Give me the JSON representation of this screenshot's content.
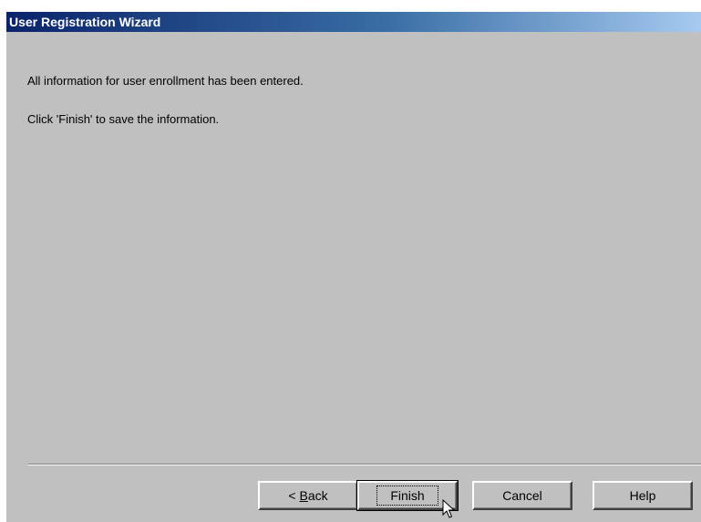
{
  "window": {
    "title": "User Registration Wizard"
  },
  "content": {
    "message_line1": "All information for user enrollment has been entered.",
    "message_line2": "Click 'Finish' to save the information."
  },
  "buttons": {
    "back_prefix": "< ",
    "back_mnemonic": "B",
    "back_rest": "ack",
    "finish": "Finish",
    "cancel": "Cancel",
    "help": "Help"
  },
  "colors": {
    "title_bar_start": "#0a246a",
    "title_bar_end": "#a6caf0",
    "dialog_background": "#c0c0c0"
  },
  "icons": {
    "mouse_cursor": "arrow-pointer-icon"
  }
}
